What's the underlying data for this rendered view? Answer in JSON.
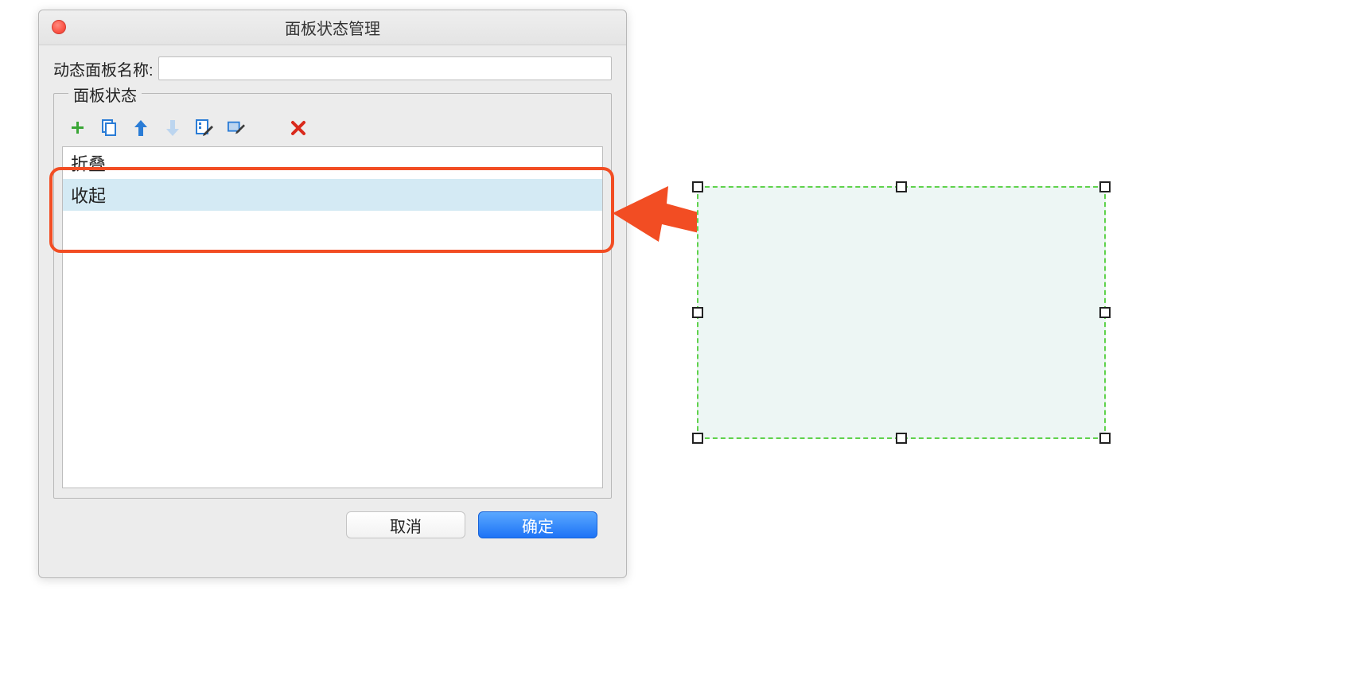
{
  "dialog": {
    "title": "面板状态管理",
    "name_label": "动态面板名称:",
    "name_value": "",
    "fieldset_legend": "面板状态",
    "toolbar": {
      "add": "add-icon",
      "duplicate": "duplicate-icon",
      "move_up": "move-up-icon",
      "move_down": "move-down-icon",
      "edit_all": "edit-all-icon",
      "edit": "edit-icon",
      "delete": "delete-icon"
    },
    "states": [
      "折叠",
      "收起"
    ],
    "selected_index": 1,
    "buttons": {
      "cancel": "取消",
      "ok": "确定"
    }
  },
  "annotation": {
    "highlight_color": "#f24d23",
    "arrow_color": "#f24d23"
  },
  "canvas": {
    "selection_fill": "#edf6f4",
    "selection_border": "#5fd24b"
  }
}
